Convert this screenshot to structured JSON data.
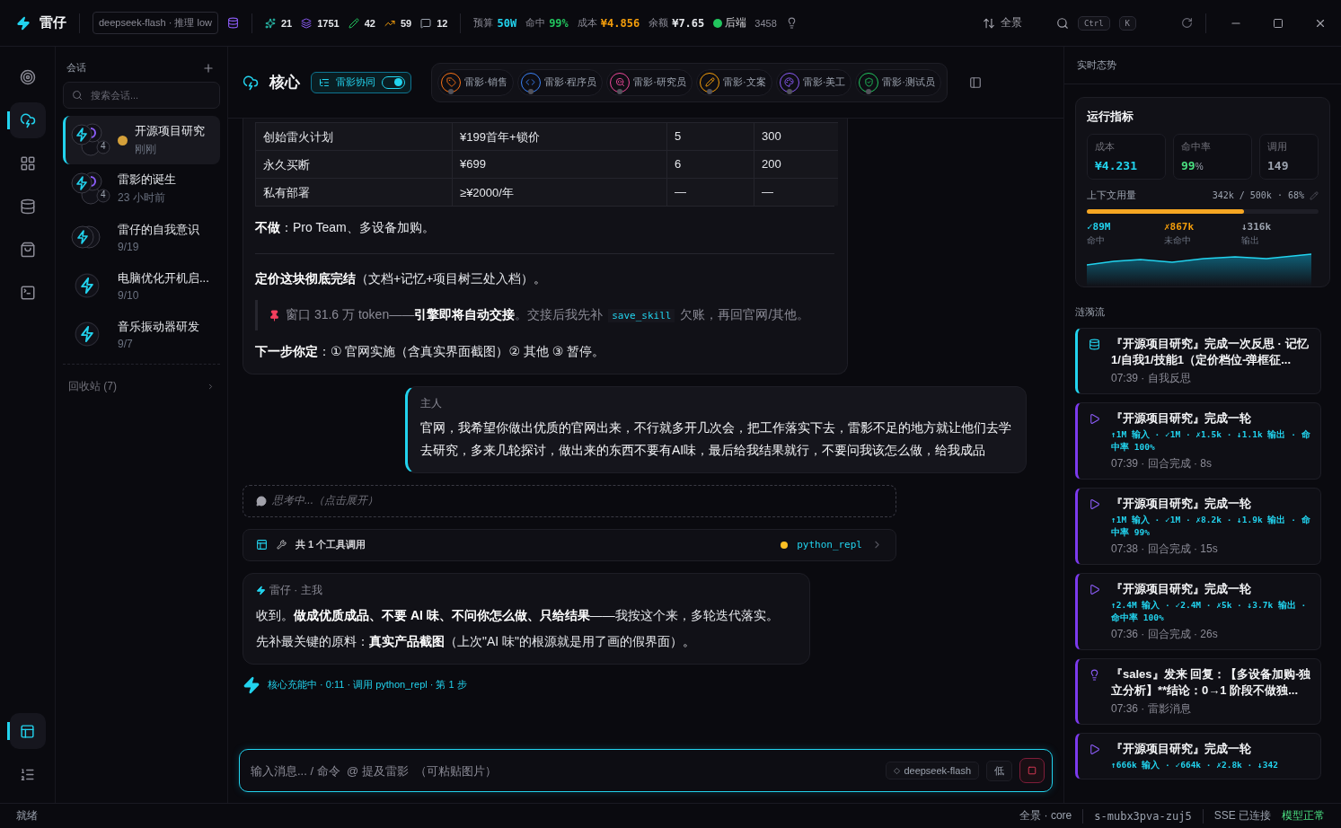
{
  "app": {
    "name": "雷仔"
  },
  "topbar": {
    "model": "deepseek-flash · 推理 low",
    "stats": [
      {
        "kind": "sparkle",
        "value": "21"
      },
      {
        "kind": "layers",
        "value": "1751"
      },
      {
        "kind": "pen",
        "value": "42"
      },
      {
        "kind": "trend",
        "value": "59"
      },
      {
        "kind": "chat",
        "value": "12"
      }
    ],
    "metrics": [
      {
        "label": "预算",
        "value": "50W",
        "color": "#22d3ee"
      },
      {
        "label": "命中",
        "value": "99%",
        "color": "#22c55e"
      },
      {
        "label": "成本",
        "value": "¥4.856",
        "color": "#f59e0b"
      },
      {
        "label": "余额",
        "value": "¥7.65",
        "color": "#e5e7eb"
      }
    ],
    "backend": {
      "label": "后端",
      "value": "3458",
      "online": true
    },
    "panorama": "全景",
    "shortcut": [
      "Ctrl",
      "K"
    ]
  },
  "rail": {
    "items": [
      {
        "kind": "target",
        "selected": false
      },
      {
        "kind": "cloud",
        "selected": true
      },
      {
        "kind": "grid",
        "selected": false
      },
      {
        "kind": "database",
        "selected": false
      },
      {
        "kind": "bag",
        "selected": false
      },
      {
        "kind": "terminal",
        "selected": false
      }
    ],
    "bottom": [
      {
        "kind": "layout",
        "selected": true
      },
      {
        "kind": "list",
        "selected": false
      }
    ]
  },
  "sidebar": {
    "title": "会话",
    "search_placeholder": "搜索会话...",
    "sessions": [
      {
        "title": "开源项目研究",
        "time": "刚刚",
        "selected": true,
        "busy": true,
        "avatar": {
          "kind": "group",
          "count": "4"
        }
      },
      {
        "title": "雷影的诞生",
        "time": "23 小时前",
        "selected": false,
        "busy": false,
        "avatar": {
          "kind": "group",
          "count": "4"
        }
      },
      {
        "title": "雷仔的自我意识",
        "time": "9/19",
        "selected": false,
        "busy": false,
        "avatar": {
          "kind": "pair"
        }
      },
      {
        "title": "电脑优化开机启...",
        "time": "9/10",
        "selected": false,
        "busy": false,
        "avatar": {
          "kind": "single"
        }
      },
      {
        "title": "音乐振动器研发",
        "time": "9/7",
        "selected": false,
        "busy": false,
        "avatar": {
          "kind": "single"
        }
      }
    ],
    "trash": "回收站 (7)"
  },
  "header": {
    "title": "核心",
    "collab": {
      "label": "雷影协同",
      "on": true
    },
    "agents": [
      {
        "kind": "sales",
        "name": "雷影·销售"
      },
      {
        "kind": "coder",
        "name": "雷影·程序员"
      },
      {
        "kind": "research",
        "name": "雷影·研究员"
      },
      {
        "kind": "writer",
        "name": "雷影·文案"
      },
      {
        "kind": "artist",
        "name": "雷影·美工"
      },
      {
        "kind": "tester",
        "name": "雷影·测试员"
      }
    ]
  },
  "chat": {
    "answer": {
      "blocks": [
        {
          "kind": "table",
          "rows": [
            [
              "创始雷火计划",
              "¥199首年+锁价",
              "5",
              "300"
            ],
            [
              "永久买断",
              "¥699",
              "6",
              "200"
            ],
            [
              "私有部署",
              "≥¥2000/年",
              "—",
              "—"
            ]
          ]
        },
        {
          "kind": "para",
          "text": "**不做**：Pro Team、多设备加购。"
        },
        {
          "kind": "divider"
        },
        {
          "kind": "para",
          "text": "**定价这块彻底完结**（文档+记忆+项目树三处入档）。"
        },
        {
          "kind": "quote",
          "before": "窗口 31.6 万 token——**引擎即将自动交接**。交接后我先补",
          "code": "save_skill",
          "after": "欠账，再回官网/其他。"
        },
        {
          "kind": "para",
          "text": "**下一步你定**：① 官网实施（含真实界面截图）② 其他 ③ 暂停。"
        }
      ]
    },
    "user": {
      "author": "主人",
      "text": "官网，我希望你做出优质的官网出来，不行就多开几次会，把工作落实下去，雷影不足的地方就让他们去学去研究，多来几轮探讨，做出来的东西不要有AI味，最后给我结果就行，不要问我该怎么做，给我成品"
    },
    "thinking": {
      "text": "思考中...（点击展开）"
    },
    "tools": {
      "summary": "共 1 个工具调用",
      "tool": "python_repl",
      "running": true
    },
    "reply": {
      "author": "雷仔 · 主我",
      "paragraphs": [
        "收到。**做成优质成品、不要 AI 味、不问你怎么做、只给结果**——我按这个来，多轮迭代落实。",
        "先补最关键的原料：**真实产品截图**（上次\"AI 味\"的根源就是用了画的假界面）。"
      ]
    },
    "progress": "核心充能中 · 0:11 · 调用 python_repl · 第 1 步"
  },
  "composer": {
    "placeholder": "输入消息... / 命令  @ 提及雷影  （可粘贴图片）",
    "model": "deepseek-flash",
    "effort": "低"
  },
  "right": {
    "title": "实时态势",
    "metrics": {
      "title": "运行指标",
      "tiles": [
        {
          "label": "成本",
          "value": "¥4.231",
          "color": "#22d3ee"
        },
        {
          "label": "命中率",
          "value": "99",
          "unit": "%",
          "color": "#4ade80"
        },
        {
          "label": "调用",
          "value": "149",
          "color": "#9ca3af"
        }
      ],
      "context": {
        "label": "上下文用量",
        "reading": "342k / 500k · 68%",
        "level": 0.68
      },
      "stats": [
        {
          "value": "✓89M",
          "label": "命中",
          "color": "#22d3ee"
        },
        {
          "value": "✗867k",
          "label": "未命中",
          "color": "#f59e0b"
        },
        {
          "value": "↓316k",
          "label": "输出",
          "color": "#9ca3af"
        }
      ]
    },
    "stream_title": "涟漪流",
    "feed": [
      {
        "kind": "reflect",
        "title": "『开源项目研究』完成一次反思 · 记忆1/自我1/技能1（定价档位-弹框征...",
        "meta": "07:39 · 自我反思"
      },
      {
        "kind": "turn",
        "title": "『开源项目研究』完成一轮",
        "detail": "↑1M 输入 · ✓1M · ✗1.5k · ↓1.1k 输出 · 命中率 100%",
        "meta": "07:39 · 回合完成 · 8s"
      },
      {
        "kind": "turn",
        "title": "『开源项目研究』完成一轮",
        "detail": "↑1M 输入 · ✓1M · ✗8.2k · ↓1.9k 输出 · 命中率 99%",
        "meta": "07:38 · 回合完成 · 15s"
      },
      {
        "kind": "turn",
        "title": "『开源项目研究』完成一轮",
        "detail": "↑2.4M 输入 · ✓2.4M · ✗5k · ↓3.7k 输出 · 命中率 100%",
        "meta": "07:36 · 回合完成 · 26s"
      },
      {
        "kind": "message",
        "title": "『sales』发来 回复：【多设备加购-独立分析】**结论：0→1 阶段不做独...",
        "meta": "07:36 · 雷影消息"
      },
      {
        "kind": "turn",
        "title": "『开源项目研究』完成一轮",
        "detail": "↑666k 输入 · ✓664k · ✗2.8k · ↓342"
      }
    ]
  },
  "status_bar": {
    "left": "就绪",
    "view": "全景 · core",
    "session": "s-mubx3pva-zuj5",
    "sse": "SSE 已连接",
    "model": "模型正常",
    "model_ok": true
  }
}
